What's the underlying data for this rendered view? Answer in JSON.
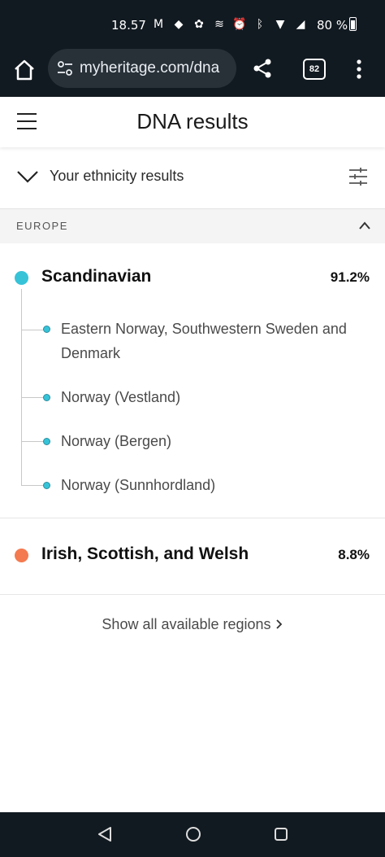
{
  "status_bar": {
    "time": "18.57",
    "icons": [
      "gmail-icon",
      "tag-icon",
      "settings-app-icon",
      "audio-icon",
      "alarm-icon",
      "bluetooth-icon",
      "wifi-icon",
      "signal-icon"
    ],
    "battery": "80 %"
  },
  "browser": {
    "url": "myheritage.com/dna",
    "tab_count": "82"
  },
  "header": {
    "title": "DNA results"
  },
  "ethnicity": {
    "label": "Your ethnicity results"
  },
  "section": {
    "label": "EUROPE"
  },
  "regions": [
    {
      "name": "Scandinavian",
      "percent": "91.2%",
      "color": "#36c3d8",
      "subregions": [
        "Eastern Norway, Southwestern Sweden and Denmark",
        "Norway (Vestland)",
        "Norway (Bergen)",
        "Norway (Sunnhordland)"
      ]
    },
    {
      "name": "Irish, Scottish, and Welsh",
      "percent": "8.8%",
      "color": "#f47a50",
      "subregions": []
    }
  ],
  "show_all": {
    "label": "Show all available regions"
  }
}
